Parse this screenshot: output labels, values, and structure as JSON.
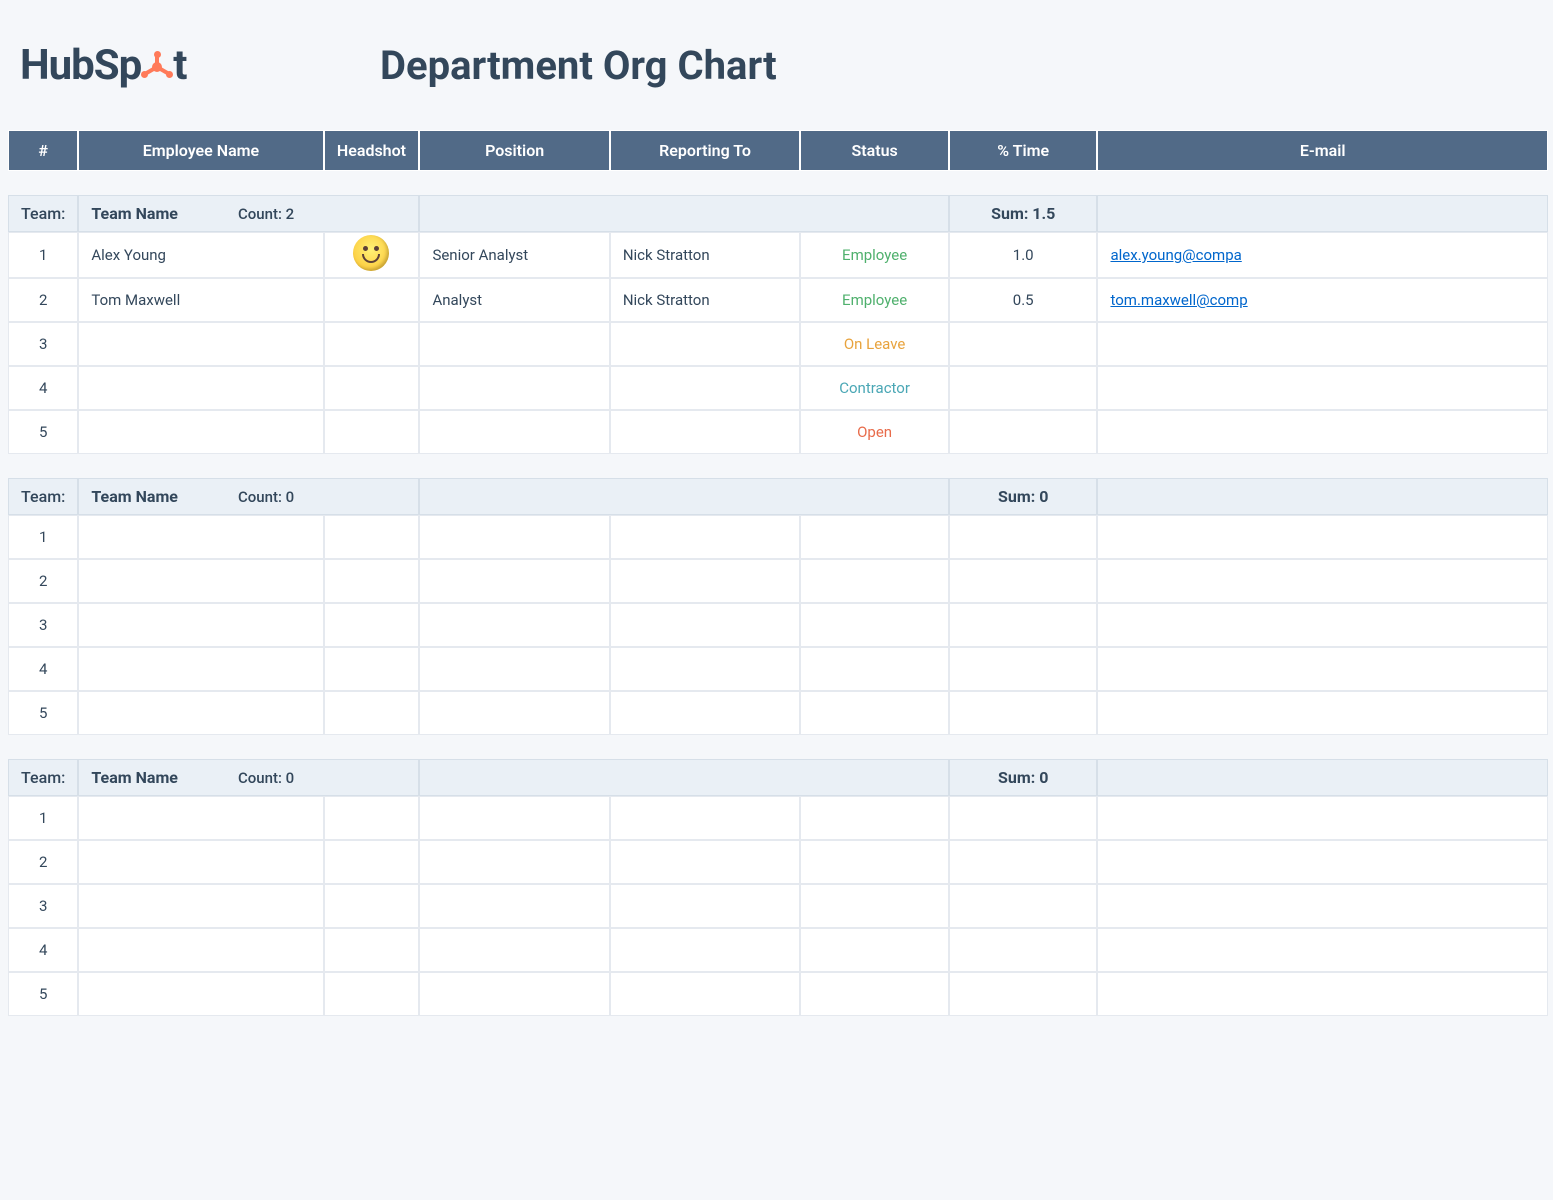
{
  "brand": {
    "part1": "HubSp",
    "part2": "t"
  },
  "title": "Department Org Chart",
  "columns": {
    "num": "#",
    "name": "Employee Name",
    "headshot": "Headshot",
    "position": "Position",
    "reporting": "Reporting To",
    "status": "Status",
    "time": "% Time",
    "email": "E-mail"
  },
  "team_label": "Team:",
  "count_label": "Count:",
  "sum_label": "Sum:",
  "status_labels": {
    "employee": "Employee",
    "on_leave": "On Leave",
    "contractor": "Contractor",
    "open": "Open"
  },
  "sections": [
    {
      "team_name": "Team Name",
      "count": "2",
      "sum": "1.5",
      "rows": [
        {
          "num": "1",
          "name": "Alex Young",
          "headshot": "smiley",
          "position": "Senior Analyst",
          "reporting": "Nick Stratton",
          "status": "employee",
          "time": "1.0",
          "email": "alex.young@compa"
        },
        {
          "num": "2",
          "name": "Tom Maxwell",
          "headshot": "",
          "position": "Analyst",
          "reporting": "Nick Stratton",
          "status": "employee",
          "time": "0.5",
          "email": "tom.maxwell@comp"
        },
        {
          "num": "3",
          "name": "",
          "headshot": "",
          "position": "",
          "reporting": "",
          "status": "on_leave",
          "time": "",
          "email": ""
        },
        {
          "num": "4",
          "name": "",
          "headshot": "",
          "position": "",
          "reporting": "",
          "status": "contractor",
          "time": "",
          "email": ""
        },
        {
          "num": "5",
          "name": "",
          "headshot": "",
          "position": "",
          "reporting": "",
          "status": "open",
          "time": "",
          "email": ""
        }
      ]
    },
    {
      "team_name": "Team Name",
      "count": "0",
      "sum": "0",
      "rows": [
        {
          "num": "1",
          "name": "",
          "headshot": "",
          "position": "",
          "reporting": "",
          "status": "",
          "time": "",
          "email": ""
        },
        {
          "num": "2",
          "name": "",
          "headshot": "",
          "position": "",
          "reporting": "",
          "status": "",
          "time": "",
          "email": ""
        },
        {
          "num": "3",
          "name": "",
          "headshot": "",
          "position": "",
          "reporting": "",
          "status": "",
          "time": "",
          "email": ""
        },
        {
          "num": "4",
          "name": "",
          "headshot": "",
          "position": "",
          "reporting": "",
          "status": "",
          "time": "",
          "email": ""
        },
        {
          "num": "5",
          "name": "",
          "headshot": "",
          "position": "",
          "reporting": "",
          "status": "",
          "time": "",
          "email": ""
        }
      ]
    },
    {
      "team_name": "Team Name",
      "count": "0",
      "sum": "0",
      "rows": [
        {
          "num": "1",
          "name": "",
          "headshot": "",
          "position": "",
          "reporting": "",
          "status": "",
          "time": "",
          "email": ""
        },
        {
          "num": "2",
          "name": "",
          "headshot": "",
          "position": "",
          "reporting": "",
          "status": "",
          "time": "",
          "email": ""
        },
        {
          "num": "3",
          "name": "",
          "headshot": "",
          "position": "",
          "reporting": "",
          "status": "",
          "time": "",
          "email": ""
        },
        {
          "num": "4",
          "name": "",
          "headshot": "",
          "position": "",
          "reporting": "",
          "status": "",
          "time": "",
          "email": ""
        },
        {
          "num": "5",
          "name": "",
          "headshot": "",
          "position": "",
          "reporting": "",
          "status": "",
          "time": "",
          "email": ""
        }
      ]
    }
  ]
}
